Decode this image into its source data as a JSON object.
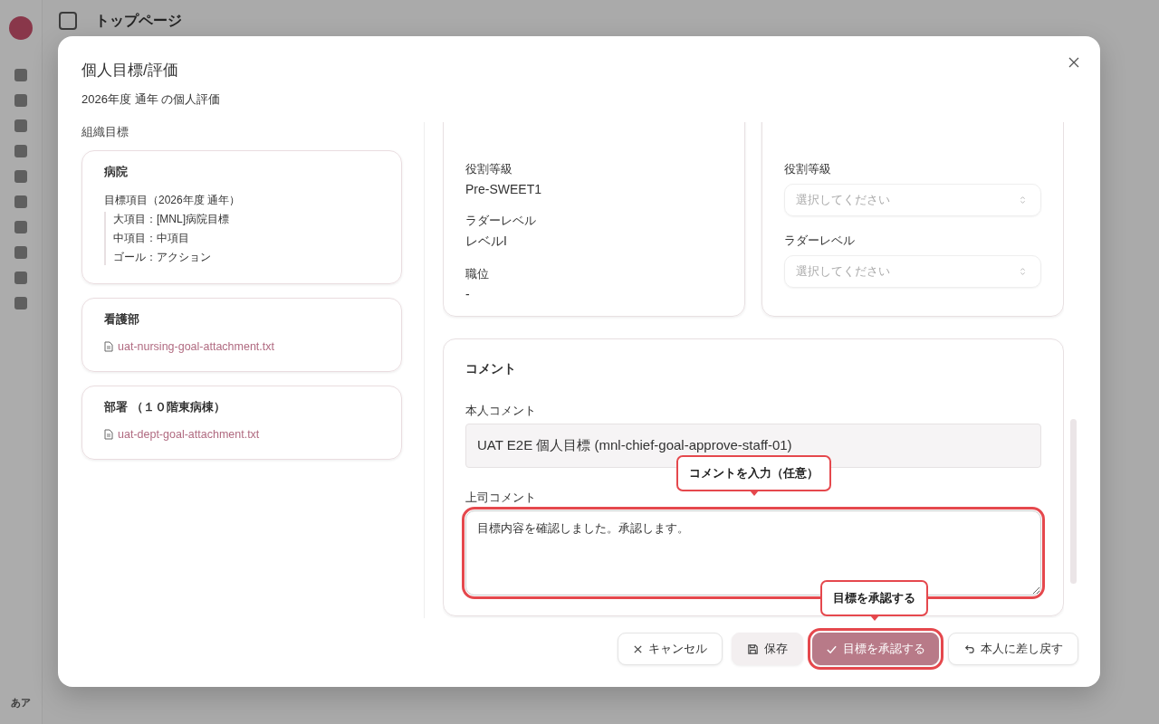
{
  "background": {
    "page_title": "トップページ",
    "user_initials": "あア"
  },
  "dialog": {
    "title": "個人目標/評価",
    "subtitle": "2026年度 通年 の個人評価"
  },
  "org_goals": {
    "label": "組織目標",
    "cards": [
      {
        "kind": "items",
        "title": "病院",
        "heading": "目標項目（2026年度 通年）",
        "items": [
          "大項目：[MNL]病院目標",
          "中項目：中項目",
          "ゴール：アクション"
        ]
      },
      {
        "kind": "attachment",
        "title": "看護部",
        "file": "uat-nursing-goal-attachment.txt"
      },
      {
        "kind": "attachment",
        "title": "部署 （１０階東病棟）",
        "file": "uat-dept-goal-attachment.txt"
      }
    ]
  },
  "current_grade": {
    "fields": [
      {
        "label": "役割等級",
        "value": "Pre-SWEET1"
      },
      {
        "label": "ラダーレベル",
        "value": "レベルI"
      },
      {
        "label": "職位",
        "value": "-"
      }
    ]
  },
  "next_year": {
    "fields": [
      {
        "label": "役割等級",
        "placeholder": "選択してください"
      },
      {
        "label": "ラダーレベル",
        "placeholder": "選択してください"
      }
    ]
  },
  "comments": {
    "title": "コメント",
    "self_label": "本人コメント",
    "self_value": "UAT E2E 個人目標 (mnl-chief-goal-approve-staff-01)",
    "boss_label": "上司コメント",
    "boss_value": "目標内容を確認しました。承認します。",
    "boss_highlighted": true
  },
  "tooltips": [
    {
      "text": "コメントを入力（任意）"
    },
    {
      "text": "目標を承認する"
    }
  ],
  "buttons": [
    {
      "kind": "cancel",
      "label": "キャンセル",
      "highlighted": false
    },
    {
      "kind": "save",
      "label": "保存",
      "highlighted": false
    },
    {
      "kind": "approve",
      "label": "目標を承認する",
      "highlighted": true
    },
    {
      "kind": "return",
      "label": "本人に差し戻す",
      "highlighted": false
    }
  ]
}
